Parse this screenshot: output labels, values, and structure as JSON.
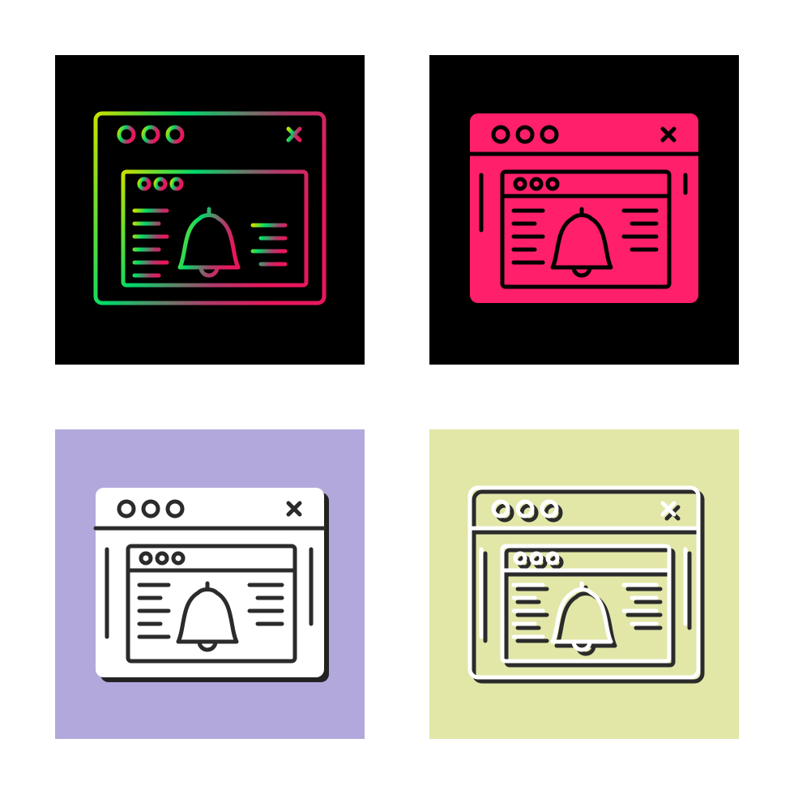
{
  "image": {
    "subject": "browser-notification-icon",
    "variants": [
      {
        "style": "gradient-line",
        "background": "#000000",
        "stroke_from": "#00d96a",
        "stroke_to": "#e8175d",
        "stroke_mid": "#c8e000"
      },
      {
        "style": "glyph",
        "background": "#000000",
        "fill": "#ff1f6a",
        "line": "#000000"
      },
      {
        "style": "solid-shadow",
        "background": "#b3a8dc",
        "fill": "#ffffff",
        "line": "#2b2b2b",
        "shadow": "#222222"
      },
      {
        "style": "line-shadow",
        "background": "#e2e7a8",
        "line": "#ffffff",
        "shadow": "#2b2b2b"
      }
    ]
  }
}
